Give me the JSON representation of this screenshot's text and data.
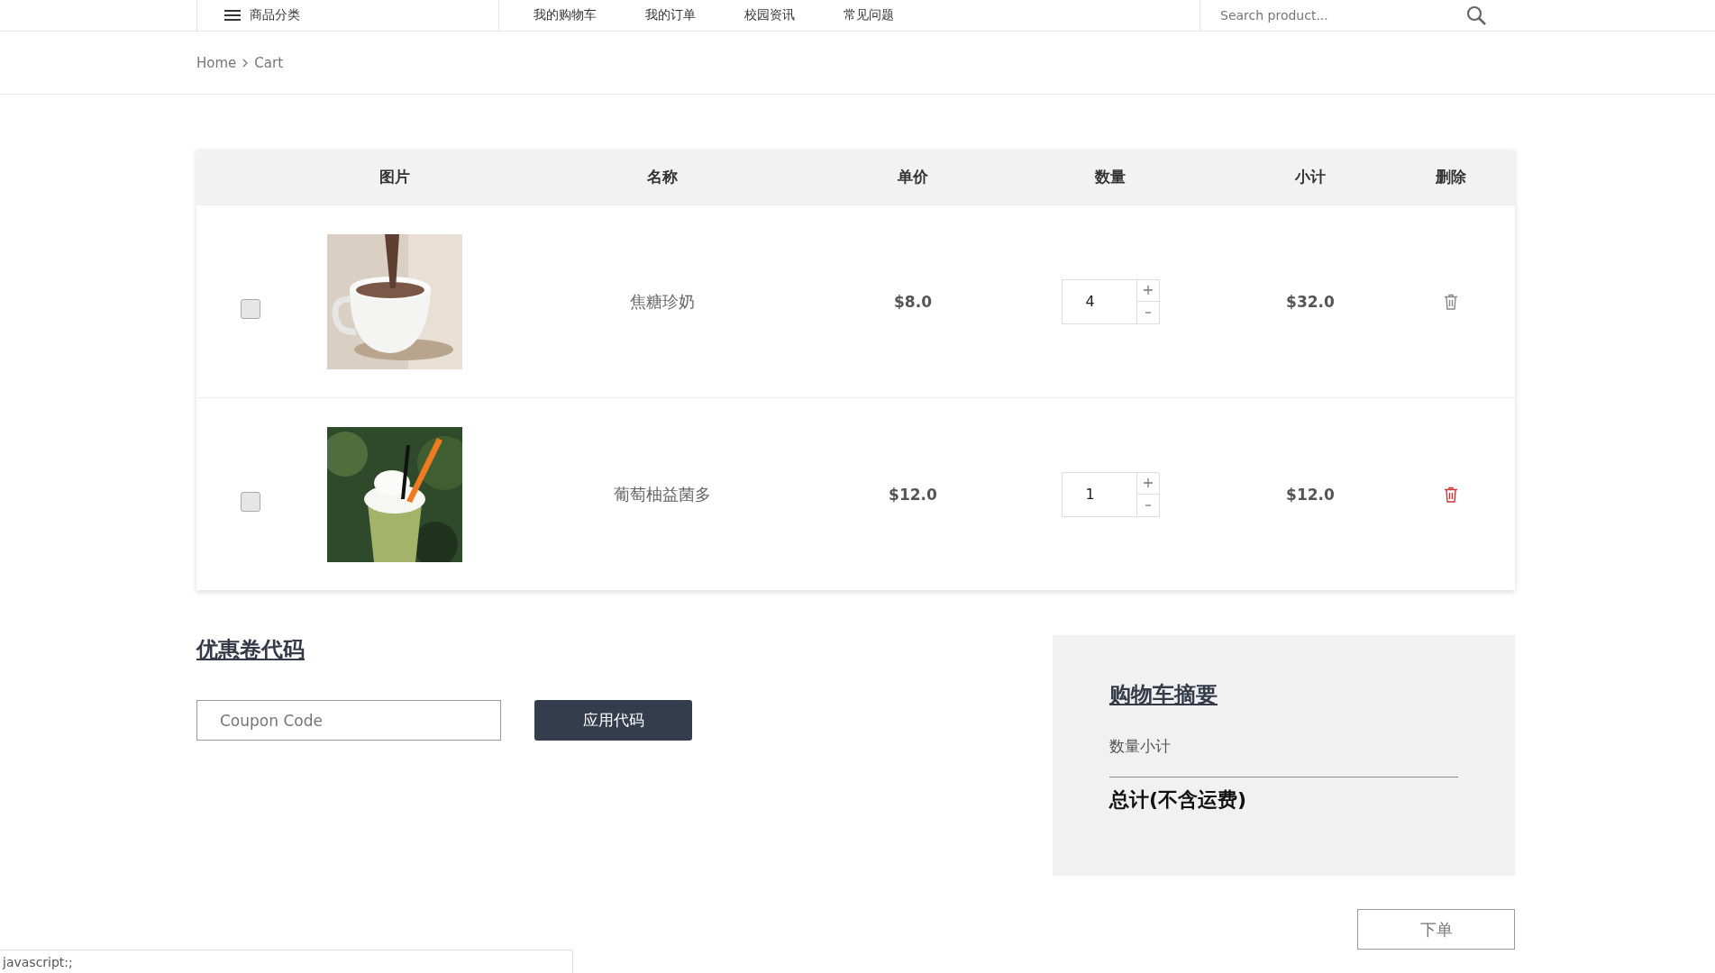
{
  "nav": {
    "category_menu": "商品分类",
    "links": [
      "我的购物车",
      "我的订单",
      "校园资讯",
      "常见问题"
    ],
    "search": {
      "placeholder": "Search product..."
    }
  },
  "breadcrumb": [
    "Home",
    "Cart"
  ],
  "cart_table": {
    "columns": [
      "图片",
      "名称",
      "单价",
      "数量",
      "小计",
      "删除"
    ],
    "rows": [
      {
        "checked": false,
        "name": "焦糖珍奶",
        "price": "$8.0",
        "quantity": "4",
        "subtotal": "$32.0",
        "delete_highlighted": false
      },
      {
        "checked": false,
        "name": "葡萄柚益菌多",
        "price": "$12.0",
        "quantity": "1",
        "subtotal": "$12.0",
        "delete_highlighted": true
      }
    ]
  },
  "coupon": {
    "title": "优惠卷代码",
    "placeholder": "Coupon Code",
    "button": "应用代码"
  },
  "summary": {
    "title": "购物车摘要",
    "quantity_label": "数量小计",
    "total_label": "总计(不含运费)"
  },
  "order_button": "下单",
  "status_bar": "javascript:;"
}
